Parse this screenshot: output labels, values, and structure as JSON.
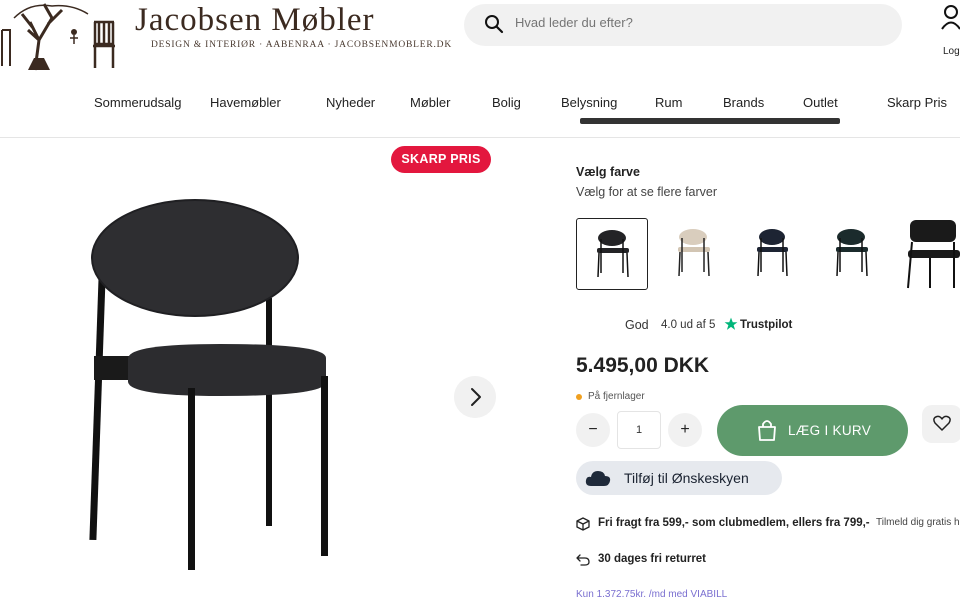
{
  "logo": {
    "title": "Jacobsen Møbler",
    "subtitle": "DESIGN & INTERIØR · AABENRAA · JACOBSENMOBLER.DK"
  },
  "search": {
    "placeholder": "Hvad leder du efter?"
  },
  "account": {
    "label": "Logi"
  },
  "nav": [
    "Sommerudsalg",
    "Havemøbler",
    "Nyheder",
    "Møbler",
    "Bolig",
    "Belysning",
    "Rum",
    "Brands",
    "Outlet",
    "Skarp Pris"
  ],
  "product": {
    "badge": "SKARP PRIS",
    "color_title": "Vælg farve",
    "color_subtitle": "Vælg for at se flere farver",
    "swatches": [
      {
        "name": "black",
        "seat": "#232326",
        "selected": true
      },
      {
        "name": "beige",
        "seat": "#d9cdbd",
        "selected": false
      },
      {
        "name": "navy",
        "seat": "#1d2433",
        "selected": false
      },
      {
        "name": "dark-green",
        "seat": "#1b2b2c",
        "selected": false
      },
      {
        "name": "black-wide",
        "seat": "#1a1a1a",
        "selected": false
      }
    ],
    "rating_word": "God",
    "rating_score": "4.0 ud af 5",
    "trustpilot": "Trustpilot",
    "price": "5.495,00 DKK",
    "stock": "På fjernlager",
    "qty_minus": "−",
    "qty_value": "1",
    "qty_plus": "+",
    "add_to_cart": "LÆG I KURV",
    "wishlist_cloud": "Tilføj til Ønskeskyen",
    "usp_shipping": "Fri fragt fra 599,- som clubmedlem, ellers fra 799,-",
    "usp_signup": "Tilmeld dig gratis h",
    "usp_returns": "30 dages fri returret",
    "financing": "Kun 1.372,75kr. /md med VIABILL"
  },
  "colors": {
    "accent_red": "#e3173e",
    "cart_green": "#5e9a6c",
    "star_green": "#00b67a",
    "stock_orange": "#f0a020"
  }
}
